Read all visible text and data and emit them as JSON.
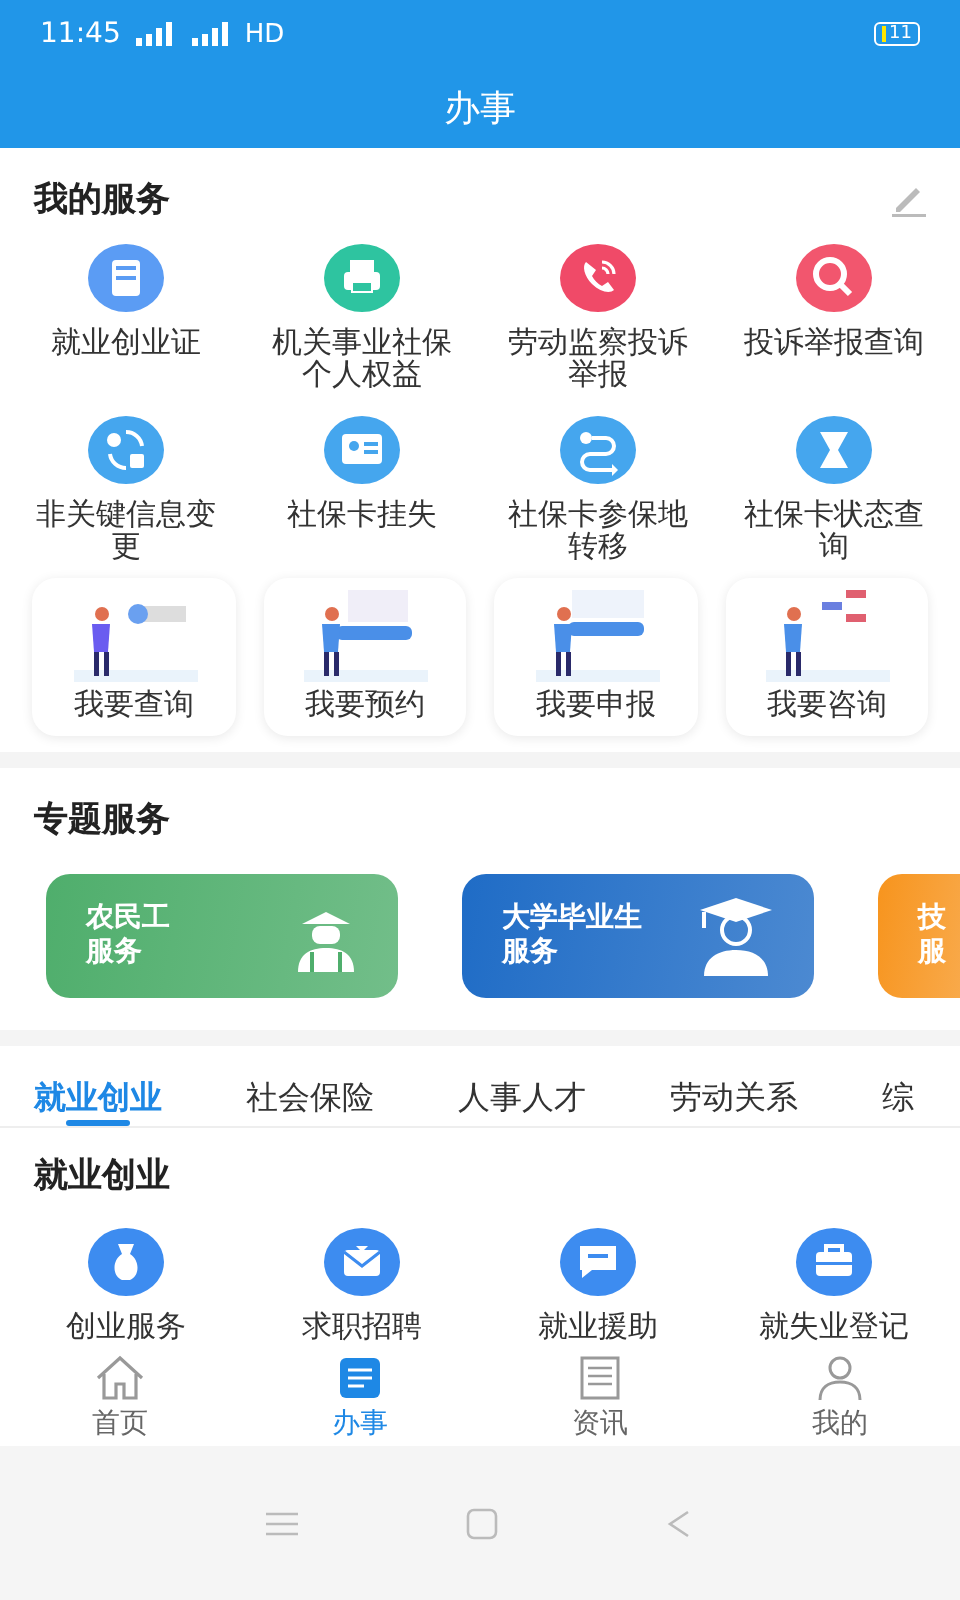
{
  "status_bar": {
    "time": "11:45",
    "network": "HD",
    "battery": "11"
  },
  "header": {
    "title": "办事"
  },
  "my_services": {
    "title": "我的服务",
    "items": [
      {
        "label": "就业创业证",
        "color": "#5b9cf4"
      },
      {
        "label": "机关事业社保个人权益",
        "color": "#2ec4a0"
      },
      {
        "label": "劳动监察投诉举报",
        "color": "#f04a68"
      },
      {
        "label": "投诉举报查询",
        "color": "#f2566e"
      },
      {
        "label": "非关键信息变更",
        "color": "#45a6ee"
      },
      {
        "label": "社保卡挂失",
        "color": "#45a6ee"
      },
      {
        "label": "社保卡参保地转移",
        "color": "#45a6ee"
      },
      {
        "label": "社保卡状态查询",
        "color": "#45a6ee"
      }
    ]
  },
  "quick_actions": [
    {
      "label": "我要查询"
    },
    {
      "label": "我要预约"
    },
    {
      "label": "我要申报"
    },
    {
      "label": "我要咨询"
    }
  ],
  "topics": {
    "title": "专题服务",
    "cards": [
      {
        "title": "农民工",
        "subtitle": "服务",
        "color": "#4fae6c"
      },
      {
        "title": "大学毕业生",
        "subtitle": "服务",
        "color": "#1f6cc6"
      },
      {
        "title": "技",
        "subtitle": "服",
        "color": "#f7941d"
      }
    ]
  },
  "category_tabs": [
    {
      "label": "就业创业",
      "selected": true
    },
    {
      "label": "社会保险",
      "selected": false
    },
    {
      "label": "人事人才",
      "selected": false
    },
    {
      "label": "劳动关系",
      "selected": false
    },
    {
      "label": "综",
      "selected": false
    }
  ],
  "category": {
    "title": "就业创业",
    "items": [
      {
        "label": "创业服务",
        "color": "#3d8cf0"
      },
      {
        "label": "求职招聘",
        "color": "#3d8cf0"
      },
      {
        "label": "就业援助",
        "color": "#3d8cf0"
      },
      {
        "label": "就失业登记",
        "color": "#3d8cf0"
      }
    ]
  },
  "bottom_nav": [
    {
      "label": "首页",
      "selected": false
    },
    {
      "label": "办事",
      "selected": true
    },
    {
      "label": "资讯",
      "selected": false
    },
    {
      "label": "我的",
      "selected": false
    }
  ]
}
